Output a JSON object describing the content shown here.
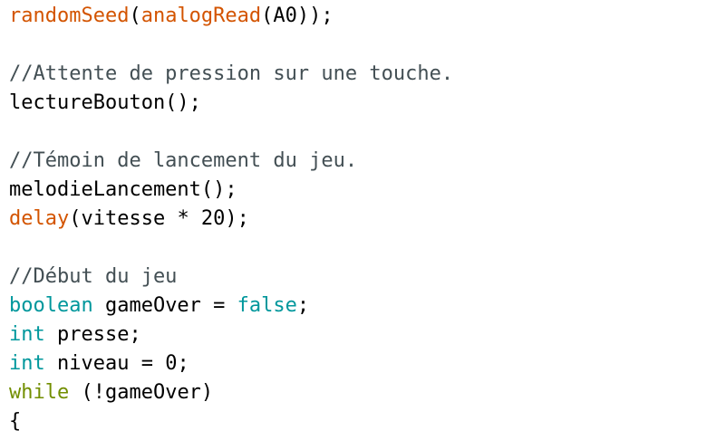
{
  "editor": {
    "colors": {
      "function": "#d35400",
      "type": "#00979c",
      "literal": "#00979c",
      "keyword": "#728e00",
      "comment": "#434f54",
      "plain": "#000000",
      "background": "#ffffff"
    },
    "lines": [
      [
        {
          "t": "randomSeed",
          "k": "function"
        },
        {
          "t": "(",
          "k": "plain"
        },
        {
          "t": "analogRead",
          "k": "function"
        },
        {
          "t": "(A0));",
          "k": "plain"
        }
      ],
      [],
      [
        {
          "t": "//Attente de pression sur une touche.",
          "k": "comment"
        }
      ],
      [
        {
          "t": "lectureBouton();",
          "k": "plain"
        }
      ],
      [],
      [
        {
          "t": "//Témoin de lancement du jeu.",
          "k": "comment"
        }
      ],
      [
        {
          "t": "melodieLancement();",
          "k": "plain"
        }
      ],
      [
        {
          "t": "delay",
          "k": "function"
        },
        {
          "t": "(vitesse * 20);",
          "k": "plain"
        }
      ],
      [],
      [
        {
          "t": "//Début du jeu",
          "k": "comment"
        }
      ],
      [
        {
          "t": "boolean",
          "k": "type"
        },
        {
          "t": " gameOver = ",
          "k": "plain"
        },
        {
          "t": "false",
          "k": "literal"
        },
        {
          "t": ";",
          "k": "plain"
        }
      ],
      [
        {
          "t": "int",
          "k": "type"
        },
        {
          "t": " presse;",
          "k": "plain"
        }
      ],
      [
        {
          "t": "int",
          "k": "type"
        },
        {
          "t": " niveau = 0;",
          "k": "plain"
        }
      ],
      [
        {
          "t": "while",
          "k": "keyword"
        },
        {
          "t": " (!gameOver)",
          "k": "plain"
        }
      ],
      [
        {
          "t": "{",
          "k": "plain"
        }
      ]
    ]
  }
}
